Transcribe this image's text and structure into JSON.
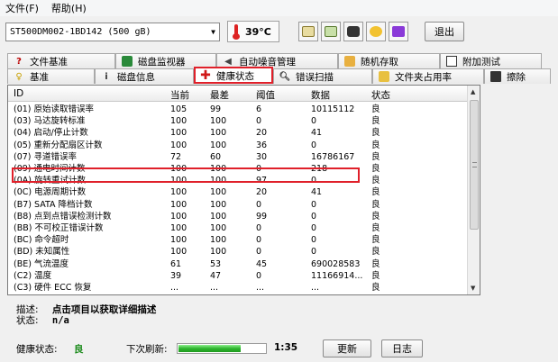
{
  "menu": [
    "文件(F)",
    "帮助(H)"
  ],
  "toolbar": {
    "drive": "ST500DM002-1BD142 (500 gB)",
    "temperature": "39°C",
    "exit_label": "退出"
  },
  "tabs_back": [
    "文件基准",
    "磁盘监视器",
    "自动噪音管理",
    "随机存取",
    "附加测试"
  ],
  "tabs_front": [
    "基准",
    "磁盘信息",
    "健康状态",
    "错误扫描",
    "文件夹占用率",
    "擦除"
  ],
  "table": {
    "headers": [
      "ID",
      "当前",
      "最差",
      "阈值",
      "数据",
      "状态"
    ],
    "rows": [
      [
        "(01) 原始读取错误率",
        "105",
        "99",
        "6",
        "10115112",
        "良"
      ],
      [
        "(03) 马达旋转标准",
        "100",
        "100",
        "0",
        "0",
        "良"
      ],
      [
        "(04) 启动/停止计数",
        "100",
        "100",
        "20",
        "41",
        "良"
      ],
      [
        "(05) 重新分配扇区计数",
        "100",
        "100",
        "36",
        "0",
        "良"
      ],
      [
        "(07) 寻道错误率",
        "72",
        "60",
        "30",
        "16786167",
        "良"
      ],
      [
        "(09) 通电时间计数",
        "100",
        "100",
        "0",
        "218",
        "良"
      ],
      [
        "(0A) 旋转重试计数",
        "100",
        "100",
        "97",
        "0",
        "良"
      ],
      [
        "(0C) 电源周期计数",
        "100",
        "100",
        "20",
        "41",
        "良"
      ],
      [
        "(B7) SATA 降档计数",
        "100",
        "100",
        "0",
        "0",
        "良"
      ],
      [
        "(B8) 点到点错误检测计数",
        "100",
        "100",
        "99",
        "0",
        "良"
      ],
      [
        "(BB) 不可校正错误计数",
        "100",
        "100",
        "0",
        "0",
        "良"
      ],
      [
        "(BC) 命令超时",
        "100",
        "100",
        "0",
        "0",
        "良"
      ],
      [
        "(BD) 未知属性",
        "100",
        "100",
        "0",
        "0",
        "良"
      ],
      [
        "(BE) 气流温度",
        "61",
        "53",
        "45",
        "690028583",
        "良"
      ],
      [
        "(C2) 温度",
        "39",
        "47",
        "0",
        "11166914...",
        "良"
      ],
      [
        "(C3) 硬件 ECC 恢复",
        "...",
        "...",
        "...",
        "...",
        "良"
      ]
    ]
  },
  "description": {
    "desc_label": "描述:",
    "desc_value": "点击项目以获取详细描述",
    "status_label": "状态:",
    "status_value": "n/a"
  },
  "statusbar": {
    "health_label": "健康状态:",
    "health_value": "良",
    "next_refresh_label": "下次刷新:",
    "progress": 0.72,
    "countdown": "1:35",
    "update_label": "更新",
    "log_label": "日志"
  },
  "colors": {
    "highlight": "#e0202a",
    "status_good": "#1a8a1a"
  }
}
